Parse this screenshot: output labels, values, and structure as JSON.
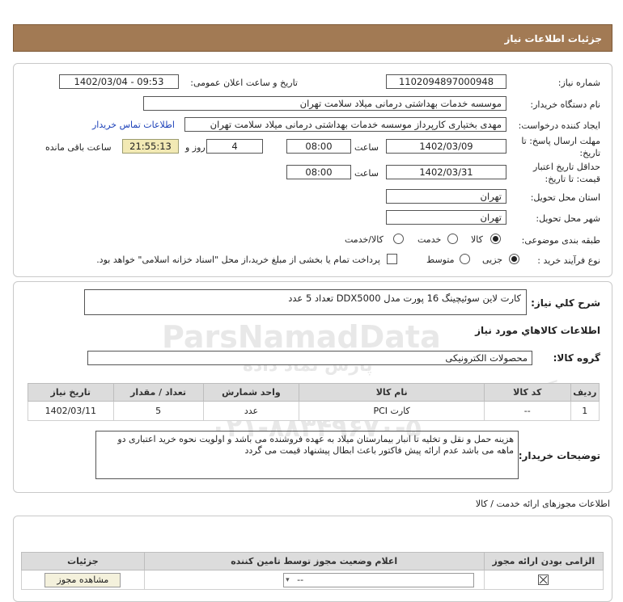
{
  "header": {
    "title": "جزئیات اطلاعات نیاز"
  },
  "form": {
    "need_number_label": "شماره نیاز:",
    "need_number": "1102094897000948",
    "announce_label": "تاریخ و ساعت اعلان عمومی:",
    "announce_value": "1402/03/04 - 09:53",
    "buyer_org_label": "نام دستگاه خریدار:",
    "buyer_org": "موسسه خدمات بهداشتی درمانی میلاد سلامت تهران",
    "requester_label": "ایجاد کننده درخواست:",
    "requester": "مهدی بختیاری کارپرداز موسسه خدمات بهداشتی درمانی میلاد سلامت تهران",
    "contact_link": "اطلاعات تماس خریدار",
    "deadline_label_1": "مهلت ارسال پاسخ: تا",
    "deadline_label_2": "تاریخ:",
    "deadline_date": "1402/03/09",
    "time_label": "ساعت",
    "deadline_time": "08:00",
    "days_value": "4",
    "days_label": "روز و",
    "remaining_time": "21:55:13",
    "remaining_label": "ساعت باقی مانده",
    "validity_label_1": "حداقل تاریخ اعتبار",
    "validity_label_2": "قیمت: تا تاریخ:",
    "validity_date": "1402/03/31",
    "validity_time": "08:00",
    "province_label": "استان محل تحویل:",
    "province": "تهران",
    "city_label": "شهر محل تحویل:",
    "city": "تهران",
    "category_label": "طبقه بندی موضوعی:",
    "category_options": [
      "کالا",
      "خدمت",
      "کالا/خدمت"
    ],
    "category_selected": "کالا",
    "process_label": "نوع فرآیند خرید :",
    "process_options": [
      "جزیی",
      "متوسط"
    ],
    "process_selected": "جزیی",
    "payment_note": "پرداخت تمام یا بخشی از مبلغ خرید،از محل \"اسناد خزانه اسلامی\" خواهد بود."
  },
  "summary": {
    "label": "شرح کلي نياز:",
    "value": "کارت لاین سوئیچینگ 16 پورت مدل DDX5000 تعداد 5 عدد"
  },
  "goods_section": {
    "title": "اطلاعات کالاهاي مورد نياز",
    "group_label": "گروه کالا:",
    "group_value": "محصولات الکترونیکی",
    "columns": [
      "ردیف",
      "کد کالا",
      "نام کالا",
      "واحد شمارش",
      "تعداد / مقدار",
      "تاریخ نیاز"
    ],
    "rows": [
      {
        "row": "1",
        "code": "--",
        "name": "کارت PCI",
        "unit": "عدد",
        "qty": "5",
        "date": "1402/03/11"
      }
    ]
  },
  "buyer_notes": {
    "label": "توضیحات خریدار:",
    "text": "هزینه حمل و نقل و تخلیه تا انبار بیمارستان میلاد به عهده فروشنده می باشد و اولویت نحوه خرید اعتباری دو ماهه می باشد عدم ارائه پیش فاکتور باعث ابطال پیشنهاد قیمت می گردد"
  },
  "permits": {
    "title": "اطلاعات مجوزهای ارائه خدمت / کالا",
    "columns": [
      "الزامی بودن ارائه مجوز",
      "اعلام وضعیت مجوز توسط تامین کننده",
      "جزئیات"
    ],
    "select_value": "--",
    "view_button": "مشاهده مجوز"
  },
  "watermark": {
    "line1": "ParsNamadData",
    "line2": "پارس نماد داده",
    "line3": "پایگاه اطلاع رسانی مناقصات و مزایدات",
    "line4": "۰۲۱-۸۸۳۴۹۶۷۰-۵"
  }
}
